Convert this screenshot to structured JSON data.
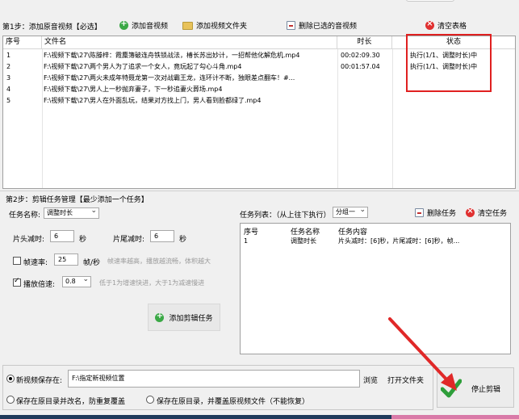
{
  "toolbar": {
    "step1_label": "第1步：添加原音视频【必选】",
    "add_media": "添加音视频",
    "add_folder": "添加视频文件夹",
    "delete_selected": "删除已选的音视频",
    "clear_table": "清空表格"
  },
  "file_table": {
    "headers": [
      "序号",
      "文件名",
      "时长",
      "状态"
    ],
    "rows": [
      {
        "no": "1",
        "name": "F:\\视频下载\\27\\陈滕梓：霞麋簿破连舟铁锁战法，椿长苏出妙计，一招帮他化解危机.mp4",
        "duration": "00:02:09.30",
        "status": "执行(1/1、调整时长)中"
      },
      {
        "no": "2",
        "name": "F:\\视频下载\\27\\两个男人为了追求一个女人，竟玩起了勾心斗角.mp4",
        "duration": "00:01:57.04",
        "status": "执行(1/1、调整时长)中"
      },
      {
        "no": "3",
        "name": "F:\\视频下载\\27\\两火未成年特聂龙第一次对战霸王龙，连环计不断，独眼差点翻车！#...",
        "duration": "",
        "status": ""
      },
      {
        "no": "4",
        "name": "F:\\视频下载\\27\\男人上一秒抛弃妻子，下一秒追妻火葬场.mp4",
        "duration": "",
        "status": ""
      },
      {
        "no": "5",
        "name": "F:\\视频下载\\27\\男人在外面乱玩，结果对方找上门，男人看到脸都绿了.mp4",
        "duration": "",
        "status": ""
      }
    ]
  },
  "step2": {
    "label": "第2步：剪辑任务管理【最少添加一个任务】",
    "task_name_label": "任务名称:",
    "task_name_value": "调整时长",
    "head_cut_label": "片头减时:",
    "head_cut_value": "6",
    "head_cut_unit": "秒",
    "tail_cut_label": "片尾减时:",
    "tail_cut_value": "6",
    "tail_cut_unit": "秒",
    "framerate_label": "帧速率:",
    "framerate_value": "25",
    "framerate_unit": "帧/秒",
    "framerate_hint": "帧速率越高，播放越流畅，体积越大",
    "speed_label": "播放倍速:",
    "speed_value": "0.8",
    "speed_hint": "低于1为增速快进，大于1为减速慢进",
    "add_task_btn": "添加剪辑任务"
  },
  "task_list": {
    "label": "任务列表：（从上往下执行）",
    "group_value": "分组一",
    "delete_task": "删除任务",
    "clear_tasks": "清空任务",
    "headers": [
      "序号",
      "任务名称",
      "任务内容"
    ],
    "rows": [
      {
        "no": "1",
        "name": "调整时长",
        "content": "片头减时：[6]秒，片尾减时：[6]秒，帧..."
      }
    ]
  },
  "output": {
    "new_location_label": "新视频保存在:",
    "path_value": "F:\\指定新视频位置",
    "browse": "浏览",
    "open_folder": "打开文件夹",
    "option_rename": "保存在原目录并改名，防重复覆盖",
    "option_overwrite": "保存在原目录，并覆盖原视频文件（不能恢复）"
  },
  "stop_button": "停止剪辑",
  "colors": {
    "highlight_red": "#e02020",
    "arrow_red": "#e02828",
    "check_green": "#2e9e3a"
  }
}
